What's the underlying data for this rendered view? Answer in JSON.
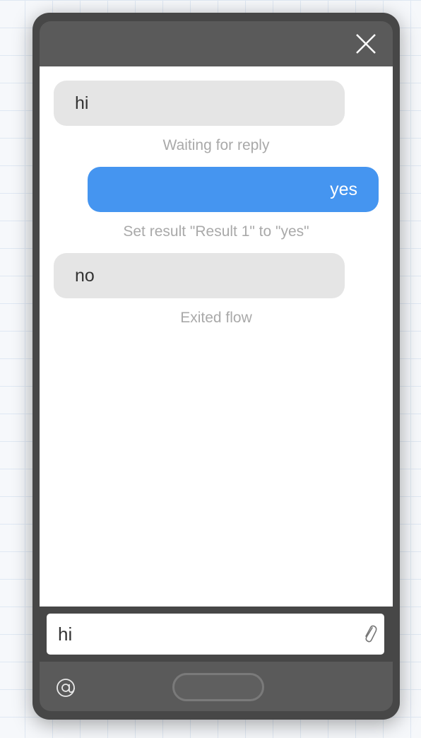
{
  "chat": {
    "messages": [
      {
        "direction": "incoming",
        "text": "hi",
        "status": "Waiting for reply"
      },
      {
        "direction": "outgoing",
        "text": "yes",
        "status": "Set result \"Result 1\" to \"yes\""
      },
      {
        "direction": "incoming",
        "text": "no",
        "status": "Exited flow"
      }
    ]
  },
  "composer": {
    "value": "hi"
  },
  "icons": {
    "close": "close-icon",
    "attach": "paperclip-icon",
    "mention": "at-sign-icon"
  },
  "colors": {
    "outgoing_bubble": "#4595f0",
    "incoming_bubble": "#e5e5e5",
    "status_text": "#a9a9a9",
    "device_frame": "#474747"
  }
}
